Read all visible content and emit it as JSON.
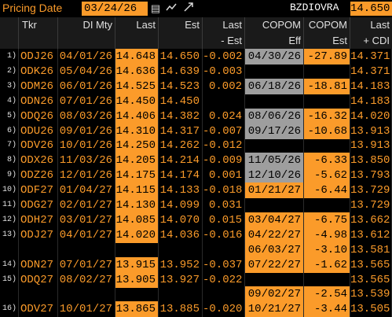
{
  "toolbar": {
    "label": "Pricing Date",
    "date": "03/24/26",
    "code": "BZDIOVRA",
    "value": "14.650",
    "icons": [
      "calendar-icon",
      "line-chart-icon",
      "expand-icon"
    ]
  },
  "headers": [
    {
      "top": "",
      "bottom": ""
    },
    {
      "top": "Tkr",
      "bottom": ""
    },
    {
      "top": "DI Mty",
      "bottom": ""
    },
    {
      "top": "Last",
      "bottom": ""
    },
    {
      "top": "Est",
      "bottom": ""
    },
    {
      "top": "Last",
      "bottom": "- Est"
    },
    {
      "top": "COPOM",
      "bottom": "Eff"
    },
    {
      "top": "COPOM",
      "bottom": "Est"
    },
    {
      "top": "Last",
      "bottom": "+ CDI"
    }
  ],
  "rows": [
    {
      "idx": "1)",
      "tkr": "ODJ26",
      "mty": "04/01/26",
      "last": "14.648",
      "est": "14.650",
      "le": "-0.002",
      "eff": "04/30/26",
      "cest": "-27.89",
      "cdi": "14.371",
      "effc": "gr",
      "cestc": "hl"
    },
    {
      "idx": "2)",
      "tkr": "ODK26",
      "mty": "05/04/26",
      "last": "14.636",
      "est": "14.639",
      "le": "-0.003",
      "eff": "",
      "cest": "",
      "cdi": "14.371",
      "effc": "",
      "cestc": ""
    },
    {
      "idx": "3)",
      "tkr": "ODM26",
      "mty": "06/01/26",
      "last": "14.525",
      "est": "14.523",
      "le": "0.002",
      "eff": "06/18/26",
      "cest": "-18.81",
      "cdi": "14.183",
      "effc": "gr",
      "cestc": "hl"
    },
    {
      "idx": "4)",
      "tkr": "ODN26",
      "mty": "07/01/26",
      "last": "14.450",
      "est": "14.450",
      "le": "",
      "eff": "",
      "cest": "",
      "cdi": "14.183",
      "effc": "",
      "cestc": ""
    },
    {
      "idx": "5)",
      "tkr": "ODQ26",
      "mty": "08/03/26",
      "last": "14.406",
      "est": "14.382",
      "le": "0.024",
      "eff": "08/06/26",
      "cest": "-16.32",
      "cdi": "14.020",
      "effc": "gr",
      "cestc": "hl"
    },
    {
      "idx": "6)",
      "tkr": "ODU26",
      "mty": "09/01/26",
      "last": "14.310",
      "est": "14.317",
      "le": "-0.007",
      "eff": "09/17/26",
      "cest": "-10.68",
      "cdi": "13.913",
      "effc": "gr",
      "cestc": "hl"
    },
    {
      "idx": "7)",
      "tkr": "ODV26",
      "mty": "10/01/26",
      "last": "14.250",
      "est": "14.262",
      "le": "-0.012",
      "eff": "",
      "cest": "",
      "cdi": "13.913",
      "effc": "",
      "cestc": ""
    },
    {
      "idx": "8)",
      "tkr": "ODX26",
      "mty": "11/03/26",
      "last": "14.205",
      "est": "14.214",
      "le": "-0.009",
      "eff": "11/05/26",
      "cest": "-6.33",
      "cdi": "13.850",
      "effc": "gr",
      "cestc": "hl"
    },
    {
      "idx": "9)",
      "tkr": "ODZ26",
      "mty": "12/01/26",
      "last": "14.175",
      "est": "14.174",
      "le": "0.001",
      "eff": "12/10/26",
      "cest": "-5.62",
      "cdi": "13.793",
      "effc": "gr",
      "cestc": "hl"
    },
    {
      "idx": "10)",
      "tkr": "ODF27",
      "mty": "01/04/27",
      "last": "14.115",
      "est": "14.133",
      "le": "-0.018",
      "eff": "01/21/27",
      "cest": "-6.44",
      "cdi": "13.729",
      "effc": "hl",
      "cestc": "hl"
    },
    {
      "idx": "11)",
      "tkr": "ODG27",
      "mty": "02/01/27",
      "last": "14.130",
      "est": "14.099",
      "le": "0.031",
      "eff": "",
      "cest": "",
      "cdi": "13.729",
      "effc": "",
      "cestc": ""
    },
    {
      "idx": "12)",
      "tkr": "ODH27",
      "mty": "03/01/27",
      "last": "14.085",
      "est": "14.070",
      "le": "0.015",
      "eff": "03/04/27",
      "cest": "-6.75",
      "cdi": "13.662",
      "effc": "hl",
      "cestc": "hl"
    },
    {
      "idx": "13)",
      "tkr": "ODJ27",
      "mty": "04/01/27",
      "last": "14.020",
      "est": "14.036",
      "le": "-0.016",
      "eff": "04/22/27",
      "cest": "-4.98",
      "cdi": "13.612",
      "effc": "hl",
      "cestc": "hl"
    },
    {
      "idx": "",
      "tkr": "",
      "mty": "",
      "last": "",
      "est": "",
      "le": "",
      "eff": "06/03/27",
      "cest": "-3.10",
      "cdi": "13.581",
      "effc": "hl",
      "cestc": "hl"
    },
    {
      "idx": "14)",
      "tkr": "ODN27",
      "mty": "07/01/27",
      "last": "13.915",
      "est": "13.952",
      "le": "-0.037",
      "eff": "07/22/27",
      "cest": "-1.62",
      "cdi": "13.565",
      "effc": "hl",
      "cestc": "hl"
    },
    {
      "idx": "15)",
      "tkr": "ODQ27",
      "mty": "08/02/27",
      "last": "13.905",
      "est": "13.927",
      "le": "-0.022",
      "eff": "",
      "cest": "",
      "cdi": "13.565",
      "effc": "",
      "cestc": ""
    },
    {
      "idx": "",
      "tkr": "",
      "mty": "",
      "last": "",
      "est": "",
      "le": "",
      "eff": "09/02/27",
      "cest": "-2.54",
      "cdi": "13.539",
      "effc": "hl",
      "cestc": "hl"
    },
    {
      "idx": "16)",
      "tkr": "ODV27",
      "mty": "10/01/27",
      "last": "13.865",
      "est": "13.885",
      "le": "-0.020",
      "eff": "10/21/27",
      "cest": "-3.44",
      "cdi": "13.505",
      "effc": "hl",
      "cestc": "hl"
    }
  ]
}
